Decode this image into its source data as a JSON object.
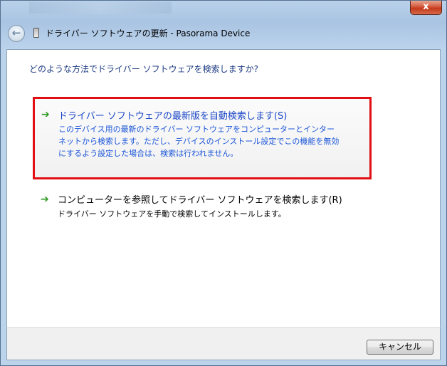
{
  "window": {
    "title": "ドライバー ソフトウェアの更新 - Pasorama Device",
    "close_label": "x",
    "back_icon": "back-arrow-icon",
    "device_icon": "device-icon"
  },
  "content": {
    "question": "どのような方法でドライバー ソフトウェアを検索しますか?",
    "options": [
      {
        "title": "ドライバー ソフトウェアの最新版を自動検索します(S)",
        "desc_lines": [
          "このデバイス用の最新のドライバー ソフトウェアをコンピューターとインター",
          "ネットから検索します。ただし、デバイスのインストール設定でこの機能を無効",
          "にするよう設定した場合は、検索は行われません。"
        ],
        "icon": "green-arrow-icon",
        "highlighted": true
      },
      {
        "title": "コンピューターを参照してドライバー ソフトウェアを検索します(R)",
        "desc": "ドライバー ソフトウェアを手動で検索してインストールします。",
        "icon": "green-arrow-icon",
        "highlighted": false
      }
    ]
  },
  "footer": {
    "cancel_label": "キャンセル"
  },
  "colors": {
    "highlight_border": "#e10f13",
    "link_blue": "#1a46c9",
    "question_blue": "#1c3a82",
    "arrow_green": "#2c9a1e"
  }
}
